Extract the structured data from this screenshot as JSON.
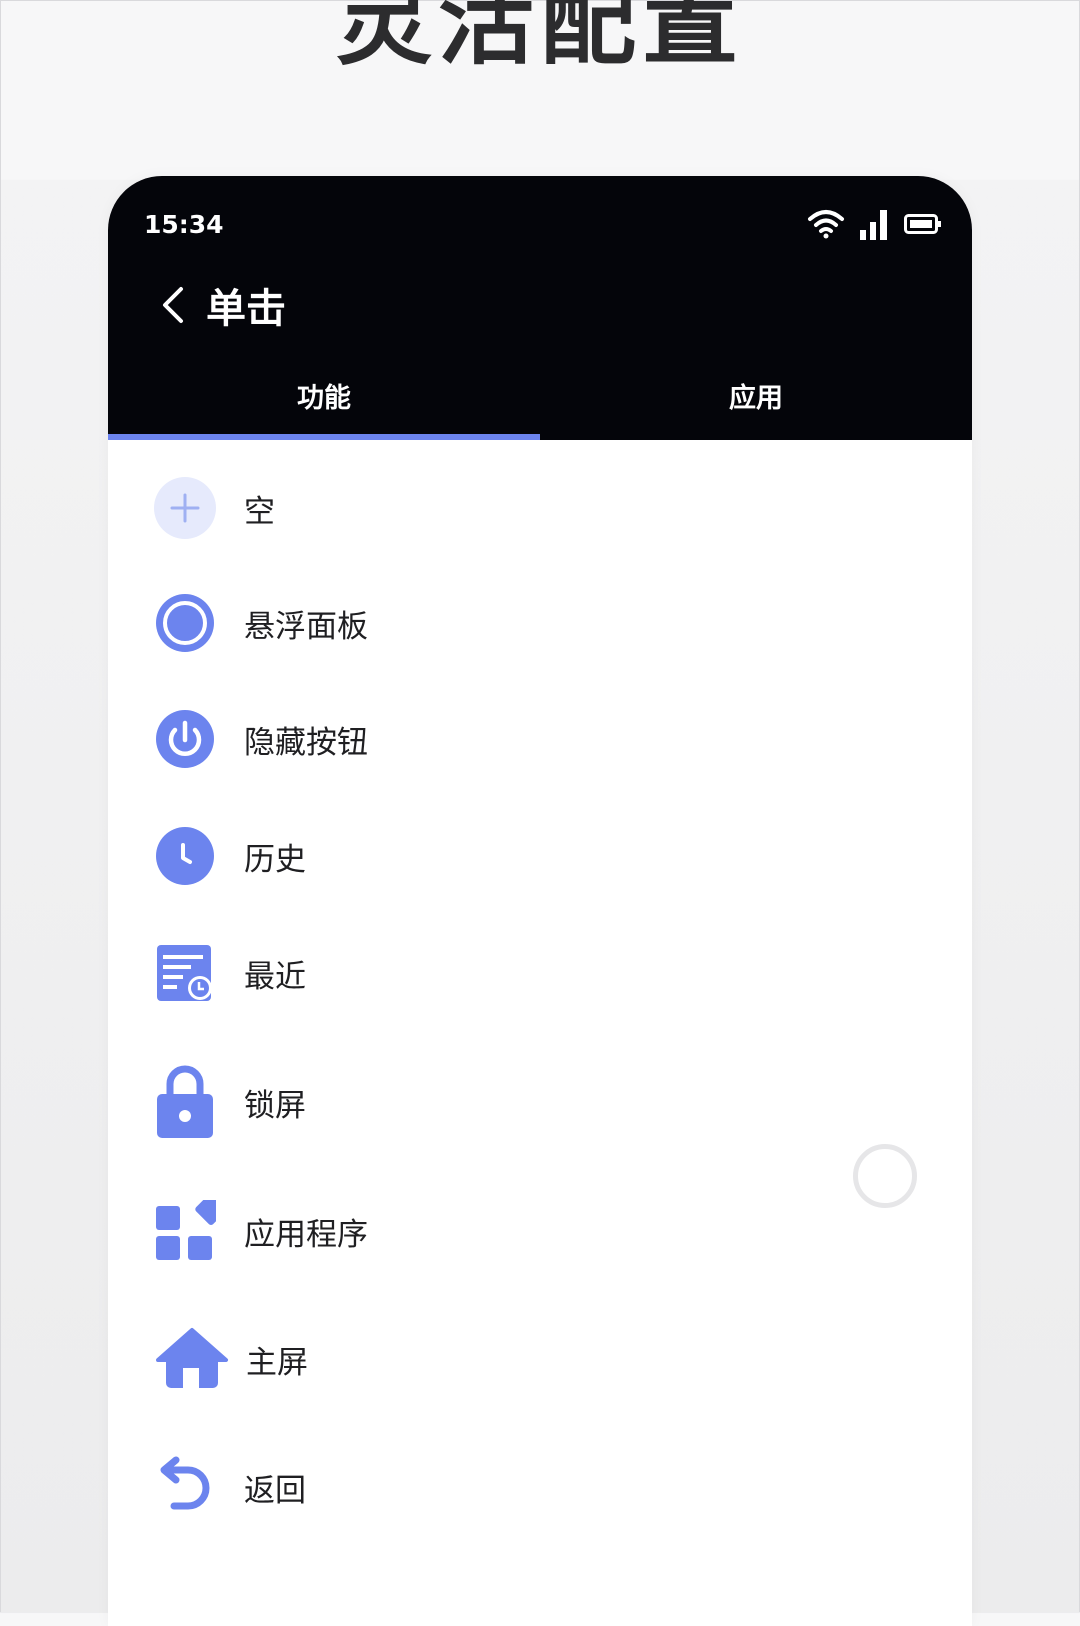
{
  "promo": {
    "title": "灵活配置"
  },
  "status_bar": {
    "time": "15:34"
  },
  "header": {
    "title": "单击"
  },
  "tabs": [
    {
      "label": "功能",
      "active": true
    },
    {
      "label": "应用",
      "active": false
    }
  ],
  "list": [
    {
      "label": "空",
      "icon": "plus-icon"
    },
    {
      "label": "悬浮面板",
      "icon": "floating-panel-icon"
    },
    {
      "label": "隐藏按钮",
      "icon": "power-icon"
    },
    {
      "label": "历史",
      "icon": "clock-icon"
    },
    {
      "label": "最近",
      "icon": "recent-tasks-icon"
    },
    {
      "label": "锁屏",
      "icon": "lock-icon"
    },
    {
      "label": "应用程序",
      "icon": "apps-icon"
    },
    {
      "label": "主屏",
      "icon": "home-icon"
    },
    {
      "label": "返回",
      "icon": "back-arrow-icon"
    }
  ],
  "colors": {
    "accent": "#6c84ee",
    "accent_light": "#e6eafc",
    "header_bg": "#04050a"
  }
}
